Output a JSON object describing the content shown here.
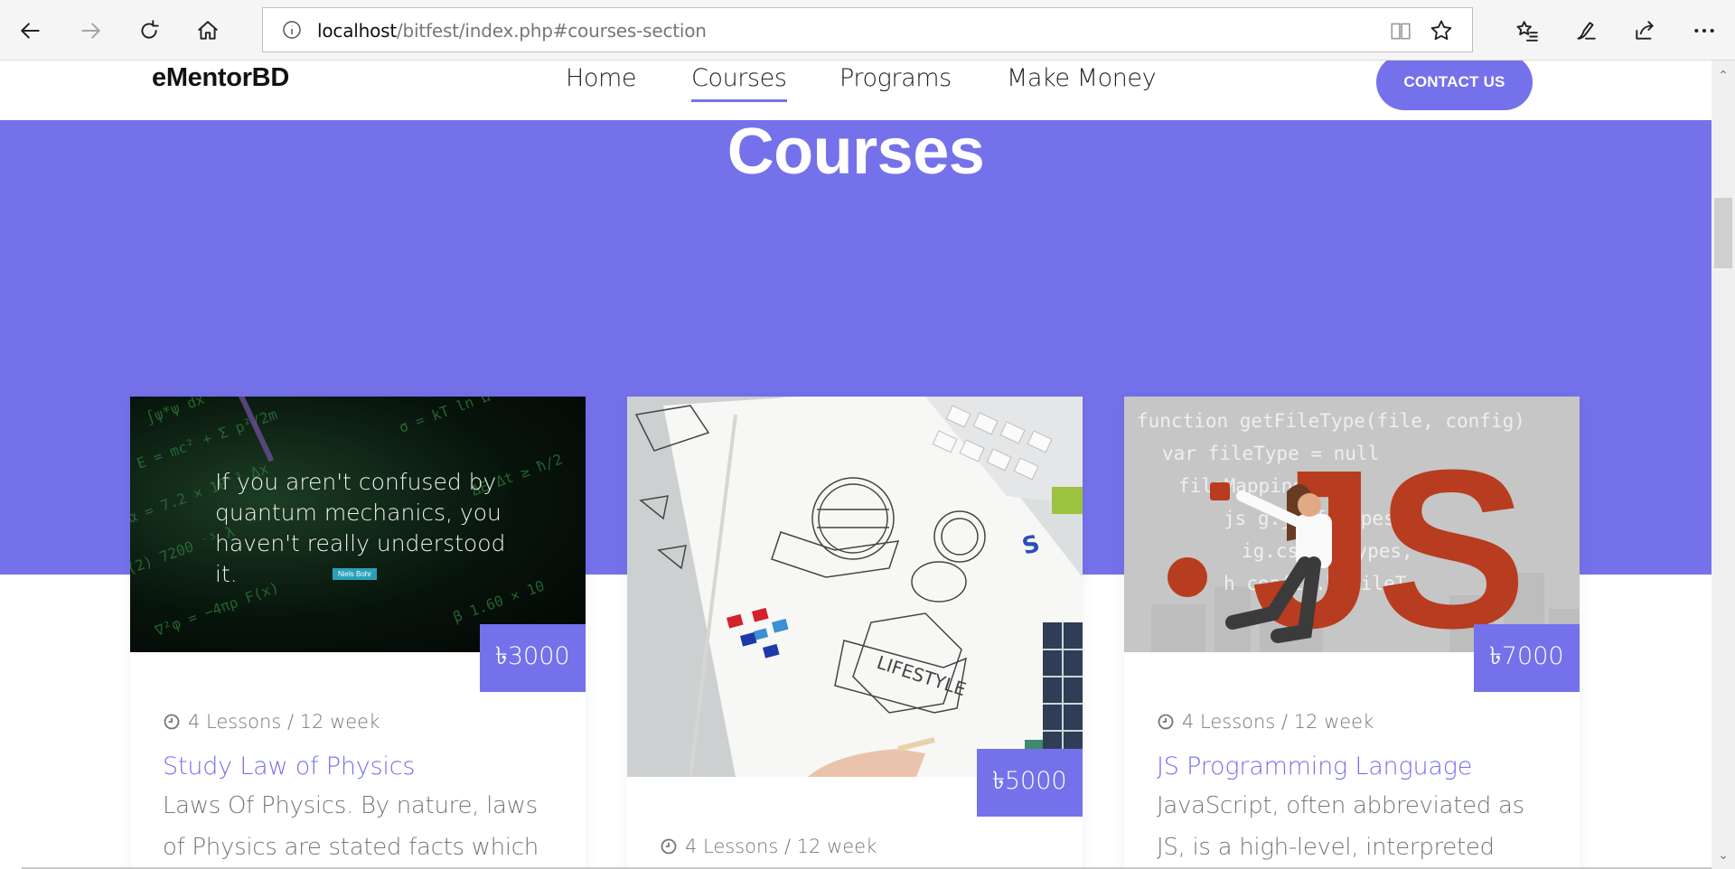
{
  "browser": {
    "url_host": "localhost",
    "url_path": "/bitfest/index.php#courses-section"
  },
  "site": {
    "logo": "eMentorBD",
    "nav": [
      "Home",
      "Courses",
      "Programs",
      "Make Money"
    ],
    "active_nav": "Courses",
    "contact_label": "CONTACT US"
  },
  "hero": {
    "title": "Courses"
  },
  "courses": [
    {
      "image_quote": "If you aren't confused by quantum mechanics, you haven't really understood it.",
      "image_attribution": "Niels Bohr",
      "price": "৳3000",
      "meta": "4 Lessons / 12 week",
      "title": "Study Law of Physics",
      "description": "Laws Of Physics. By nature, laws of Physics are stated facts which have"
    },
    {
      "image_text": "LIFESTYLE",
      "price": "৳5000",
      "meta": "4 Lessons / 12 week"
    },
    {
      "image_code": "function getFileType(file, config)\n  var fileType = null\n  fileMapping = \n  js .g.js.f Types,\n  ig.css.f Types,\n  h  config.h  fileT",
      "image_logo": "JS",
      "price": "৳7000",
      "meta": "4 Lessons / 12 week",
      "title": "JS Programming Language",
      "description": "JavaScript, often abbreviated as JS, is a high-level, interpreted scripting"
    }
  ],
  "colors": {
    "accent": "#7571ea"
  }
}
